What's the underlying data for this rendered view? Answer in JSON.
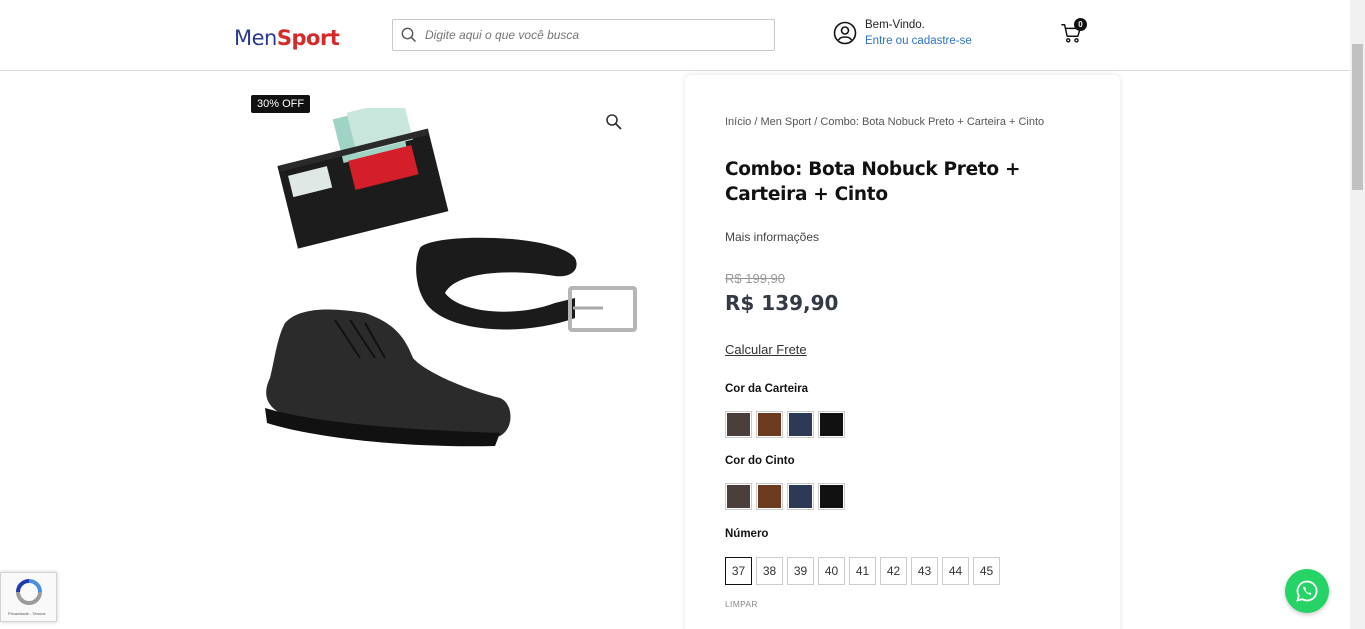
{
  "header": {
    "logo_part1": "Men",
    "logo_part2": "Sport",
    "search_placeholder": "Digite aqui o que você busca",
    "welcome": "Bem-Vindo.",
    "login_link": "Entre ou cadastre-se",
    "cart_count": "0"
  },
  "product": {
    "discount_badge": "30% OFF",
    "breadcrumb": {
      "home": "Início",
      "sep1": " / ",
      "category": "Men Sport",
      "sep2": " / ",
      "current": "Combo: Bota Nobuck Preto + Carteira + Cinto"
    },
    "title": "Combo: Bota Nobuck Preto + Carteira + Cinto",
    "more_info": "Mais informações",
    "old_price": "R$ 199,90",
    "price": "R$ 139,90",
    "shipping_link": "Calcular Frete",
    "wallet_color_label": "Cor da Carteira",
    "belt_color_label": "Cor do Cinto",
    "colors": [
      "#4a3f3b",
      "#6b3a1f",
      "#2e3a55",
      "#111111"
    ],
    "size_label": "Número",
    "sizes": [
      "37",
      "38",
      "39",
      "40",
      "41",
      "42",
      "43",
      "44",
      "45"
    ],
    "selected_size": "37",
    "clear_label": "LIMPAR"
  },
  "recaptcha": {
    "text": "Privacidade - Termos"
  }
}
